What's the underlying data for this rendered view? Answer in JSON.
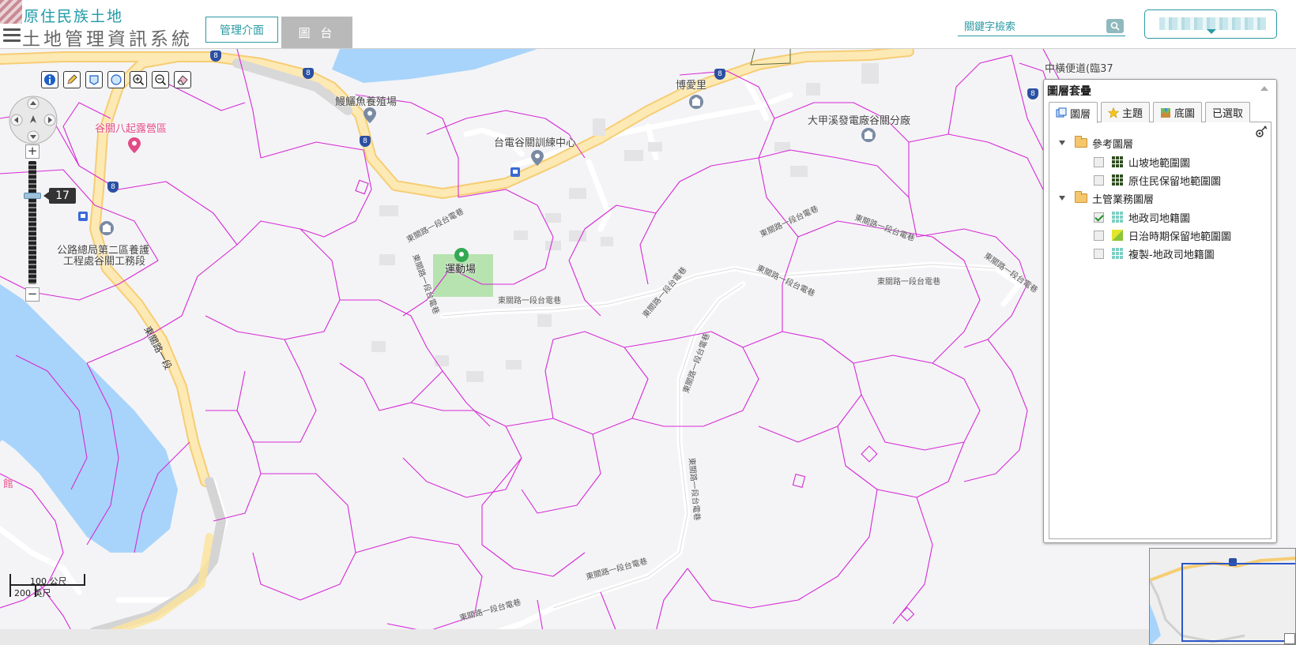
{
  "header": {
    "title_line1": "原住民族土地",
    "title_line2": "土地管理資訊系統",
    "admin_button": "管理介面",
    "map_button": "圖 台",
    "search_placeholder": "關鍵字檢索"
  },
  "map": {
    "zoom_level": "17",
    "pois": [
      {
        "name": "鰻鱺魚養殖場"
      },
      {
        "name": "博愛里"
      },
      {
        "name": "大甲溪發電廠谷關分廠"
      },
      {
        "name": "台電谷關訓練中心"
      },
      {
        "name": "谷關八起露營區"
      },
      {
        "name": "公路總局第二區養護"
      },
      {
        "name": "工程處谷關工務段"
      },
      {
        "name": "運動場"
      },
      {
        "name": "中橫便道(臨37"
      }
    ],
    "road_labels": [
      "東關路一段",
      "東關路一段台電巷"
    ],
    "route_number": "8",
    "partial_label": "館",
    "scale": {
      "metric": "100 公尺",
      "imperial": "200 英尺"
    }
  },
  "layer_panel": {
    "title": "圖層套疊",
    "tabs": [
      {
        "label": "圖層",
        "icon": "layers-icon"
      },
      {
        "label": "主題",
        "icon": "star-icon"
      },
      {
        "label": "底圖",
        "icon": "basemap-icon"
      },
      {
        "label": "已選取",
        "icon": ""
      }
    ],
    "groups": [
      {
        "name": "參考圖層",
        "items": [
          {
            "label": "山坡地範圍圖",
            "checked": false,
            "color": "#2f4f1f"
          },
          {
            "label": "原住民保留地範圍圖",
            "checked": false,
            "color": "#2f4f1f"
          }
        ]
      },
      {
        "name": "土管業務圖層",
        "items": [
          {
            "label": "地政司地籍圖",
            "checked": true,
            "color": "#7ccfc4"
          },
          {
            "label": "日治時期保留地範圍圖",
            "checked": false,
            "color": "#c7d62b"
          },
          {
            "label": "複製-地政司地籍圖",
            "checked": false,
            "color": "#7ccfc4"
          }
        ]
      }
    ]
  },
  "colors": {
    "accent": "#2a9aa3",
    "parcel_line": "#d62ad6",
    "water": "#a8d4fb",
    "highway": "#fde39a"
  }
}
